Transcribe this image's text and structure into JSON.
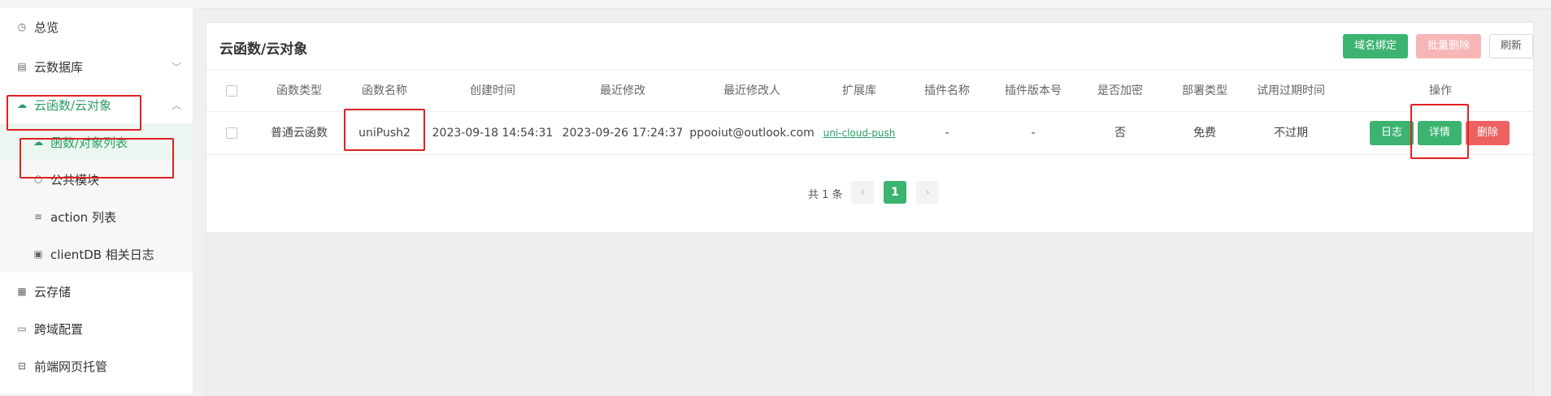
{
  "sidebar": {
    "items": [
      {
        "label": "总览",
        "icon": "clock-icon"
      },
      {
        "label": "云数据库",
        "icon": "list-icon"
      },
      {
        "label": "云函数/云对象",
        "icon": "cloud-icon"
      },
      {
        "label": "函数/对象列表",
        "icon": "cloud-icon"
      },
      {
        "label": "公共模块",
        "icon": "cube-icon"
      },
      {
        "label": "action 列表",
        "icon": "lines-icon"
      },
      {
        "label": "clientDB 相关日志",
        "icon": "log-icon"
      },
      {
        "label": "云存储",
        "icon": "storage-icon"
      },
      {
        "label": "跨域配置",
        "icon": "window-icon"
      },
      {
        "label": "前端网页托管",
        "icon": "host-icon"
      }
    ]
  },
  "main": {
    "title": "云函数/云对象",
    "buttons": {
      "domain_bind": "域名绑定",
      "batch_delete": "批量删除",
      "refresh": "刷新"
    },
    "columns": [
      "函数类型",
      "函数名称",
      "创建时间",
      "最近修改",
      "最近修改人",
      "扩展库",
      "插件名称",
      "插件版本号",
      "是否加密",
      "部署类型",
      "试用过期时间",
      "操作"
    ],
    "row": {
      "type": "普通云函数",
      "name": "uniPush2",
      "created": "2023-09-18 14:54:31",
      "modified": "2023-09-26 17:24:37",
      "modifier": "ppooiut@outlook.com",
      "ext_lib": "uni-cloud-push",
      "plugin_name": "-",
      "plugin_version": "-",
      "encrypted": "否",
      "deploy_type": "免费",
      "trial_expire": "不过期",
      "actions": {
        "log": "日志",
        "detail": "详情",
        "delete": "删除"
      }
    },
    "pagination": {
      "total": "共 1 条",
      "current": "1",
      "prev": "‹",
      "next": "›"
    }
  },
  "colors": {
    "accent": "#3cb371",
    "danger": "#ee6161",
    "highlight": "#e02020"
  }
}
